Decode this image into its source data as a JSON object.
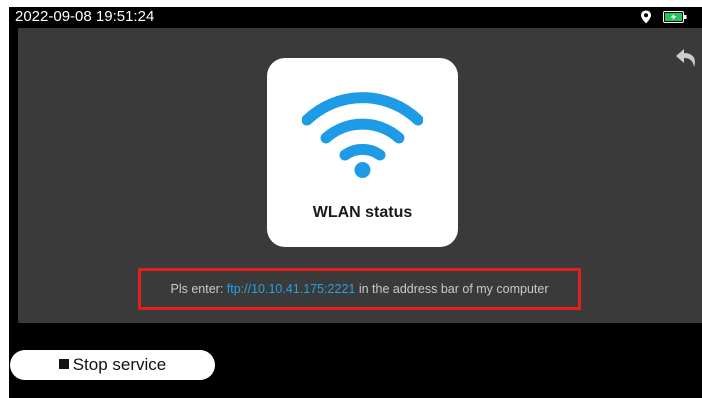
{
  "status_bar": {
    "datetime": "2022-09-08 19:51:24",
    "icons": [
      "location-icon",
      "battery-charging-icon"
    ]
  },
  "toolbar": {
    "back_icon": "back-arrow-icon"
  },
  "wlan_card": {
    "icon": "wifi-icon",
    "label": "WLAN status",
    "accent_color": "#1e9be6"
  },
  "message": {
    "prefix": "Pls enter: ",
    "ftp_address": "ftp://10.10.41.175:2221",
    "suffix": " in the address bar of my computer",
    "highlight_color": "#e0201d"
  },
  "actions": {
    "stop_label": "Stop service",
    "stop_icon": "stop-square-icon"
  }
}
